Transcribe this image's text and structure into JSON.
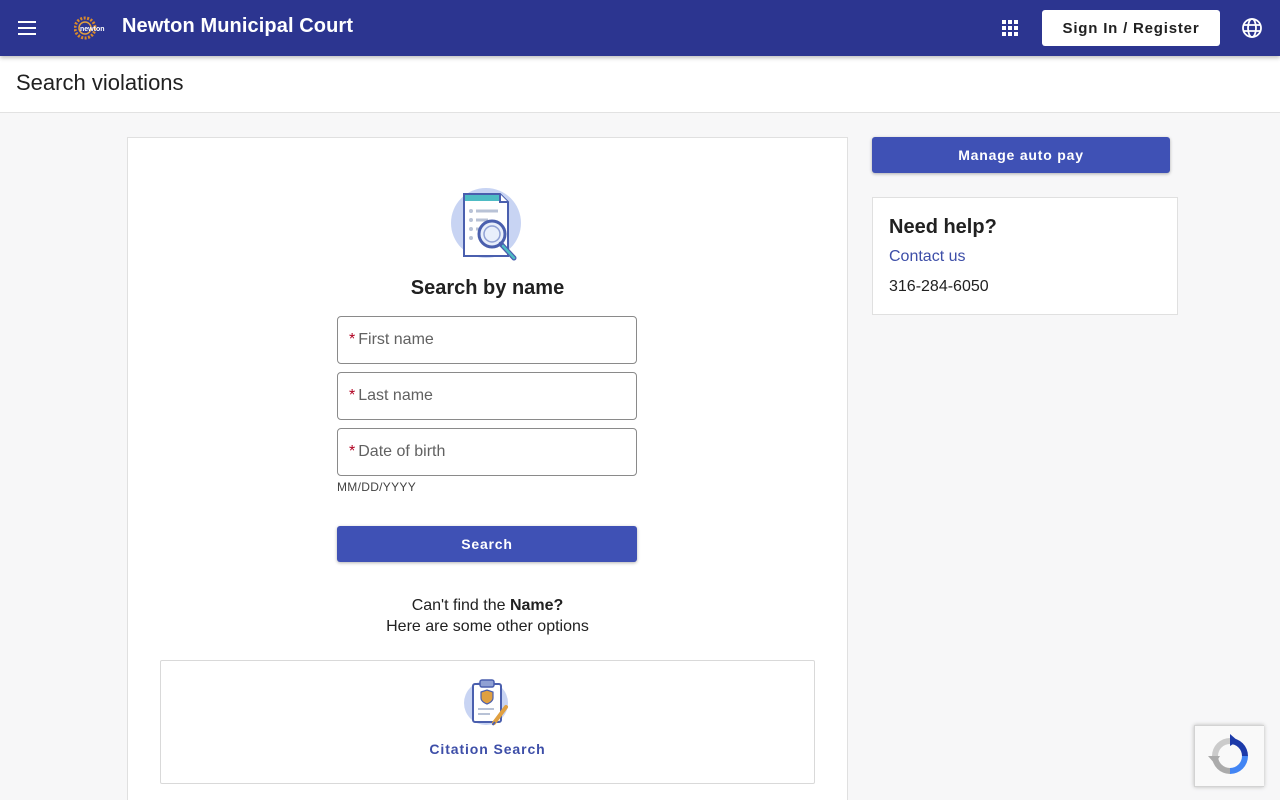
{
  "appbar": {
    "title": "Newton Municipal Court",
    "logo_text": "newton",
    "signin_label": "Sign In / Register",
    "menu_icon": "hamburger-menu-icon",
    "apps_icon": "apps-grid-icon",
    "language_icon": "globe-icon",
    "color": "#2c3590"
  },
  "page": {
    "title": "Search violations"
  },
  "search": {
    "illustration_icon": "document-search-icon",
    "heading": "Search by name",
    "required_mark": "*",
    "first_name_label": "First name",
    "last_name_label": "Last name",
    "dob_label": "Date of birth",
    "dob_hint": "MM/DD/YYYY",
    "button_label": "Search",
    "button_color": "#3f51b5"
  },
  "other_options": {
    "line1_prefix": "Can't find the ",
    "line1_bold": "Name?",
    "line2": "Here are some other options",
    "citation_icon": "clipboard-badge-icon",
    "citation_label": "Citation Search"
  },
  "sidebar": {
    "autopay_label": "Manage auto pay",
    "help_title": "Need help?",
    "contact_label": "Contact us",
    "phone": "316-284-6050"
  },
  "recaptcha": {
    "icon": "recaptcha-icon"
  }
}
